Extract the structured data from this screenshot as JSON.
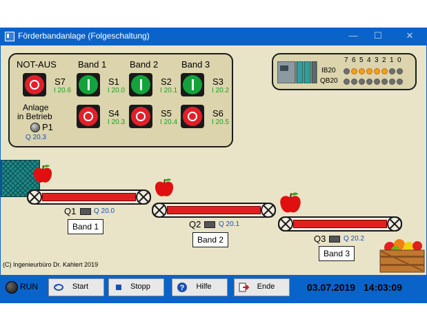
{
  "window": {
    "title": "Förderbandanlage (Folgeschaltung)",
    "minimize": "—",
    "maximize": "☐",
    "close": "✕"
  },
  "control_panel": {
    "notaus_label": "NOT-AUS",
    "band1_label": "Band 1",
    "band2_label": "Band 2",
    "band3_label": "Band 3",
    "s7": {
      "name": "S7",
      "addr": "I 20.6"
    },
    "s1": {
      "name": "S1",
      "addr": "I 20.0"
    },
    "s2": {
      "name": "S2",
      "addr": "I 20.1"
    },
    "s3": {
      "name": "S3",
      "addr": "I 20.2"
    },
    "s4": {
      "name": "S4",
      "addr": "I 20.3"
    },
    "s5": {
      "name": "S5",
      "addr": "I 20.4"
    },
    "s6": {
      "name": "S6",
      "addr": "I 20.5"
    },
    "anlage_label_1": "Anlage",
    "anlage_label_2": "in Betrieb",
    "p1": {
      "name": "P1",
      "addr": "Q 20.3"
    }
  },
  "io_panel": {
    "bits": [
      "7",
      "6",
      "5",
      "4",
      "3",
      "2",
      "1",
      "0"
    ],
    "ib_label": "IB20",
    "qb_label": "QB20",
    "ib_states": [
      false,
      true,
      true,
      true,
      true,
      true,
      false,
      false
    ],
    "qb_states": [
      false,
      false,
      false,
      false,
      false,
      false,
      false,
      false
    ],
    "led_on_color": "#f0a020",
    "led_off_color": "#6e6e6e"
  },
  "conveyors": [
    {
      "q_name": "Q1",
      "q_addr": "Q 20.0",
      "band": "Band 1"
    },
    {
      "q_name": "Q2",
      "q_addr": "Q 20.1",
      "band": "Band 2"
    },
    {
      "q_name": "Q3",
      "q_addr": "Q 20.2",
      "band": "Band 3"
    }
  ],
  "copyright": "(C) Ingenieurbüro Dr. Kahlert 2019",
  "status_bar": {
    "run_label": "RUN",
    "start_label": "Start",
    "stopp_label": "Stopp",
    "hilfe_label": "Hilfe",
    "ende_label": "Ende",
    "date": "03.07.2019",
    "time": "14:03:09"
  }
}
